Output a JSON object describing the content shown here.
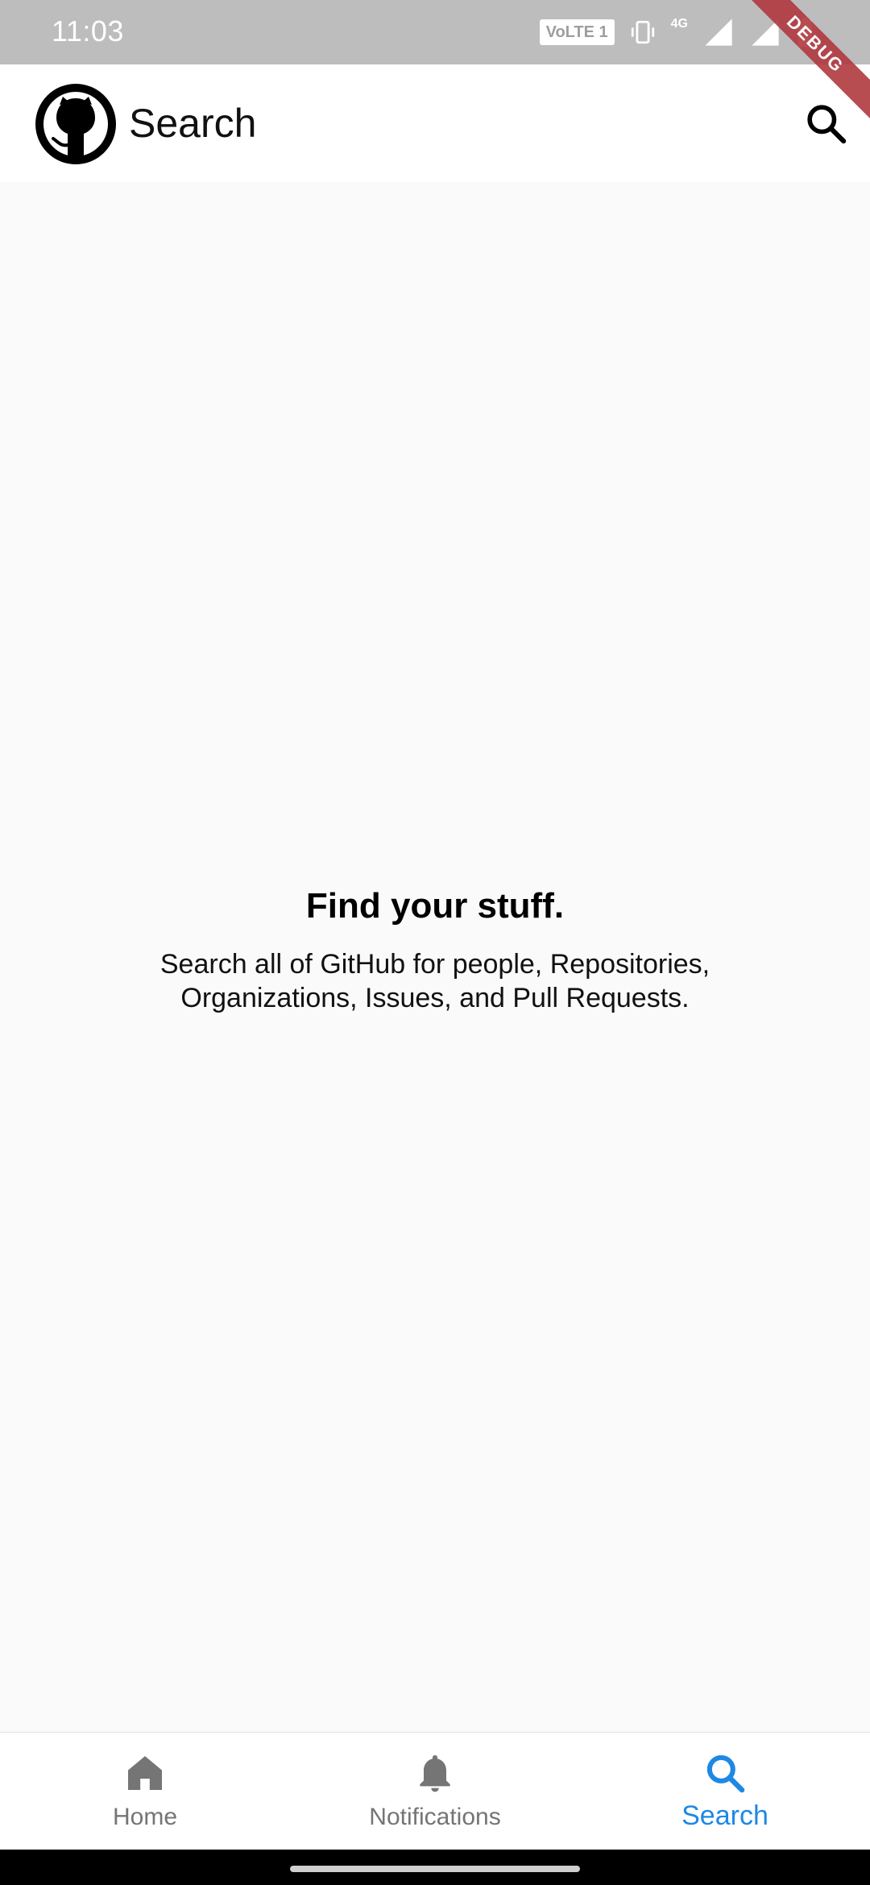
{
  "status_bar": {
    "time": "11:03",
    "volte": "VoLTE 1",
    "network": "4G"
  },
  "debug_banner": "DEBUG",
  "app_bar": {
    "title": "Search"
  },
  "empty_state": {
    "title": "Find your stuff.",
    "description": "Search all of GitHub for people, Repositories, Organizations, Issues, and Pull Requests."
  },
  "bottom_nav": {
    "items": [
      {
        "label": "Home",
        "icon": "home-icon",
        "active": false
      },
      {
        "label": "Notifications",
        "icon": "bell-icon",
        "active": false
      },
      {
        "label": "Search",
        "icon": "search-icon",
        "active": true
      }
    ]
  },
  "colors": {
    "active": "#1e88e5",
    "inactive": "#757575",
    "background": "#fafafa"
  }
}
